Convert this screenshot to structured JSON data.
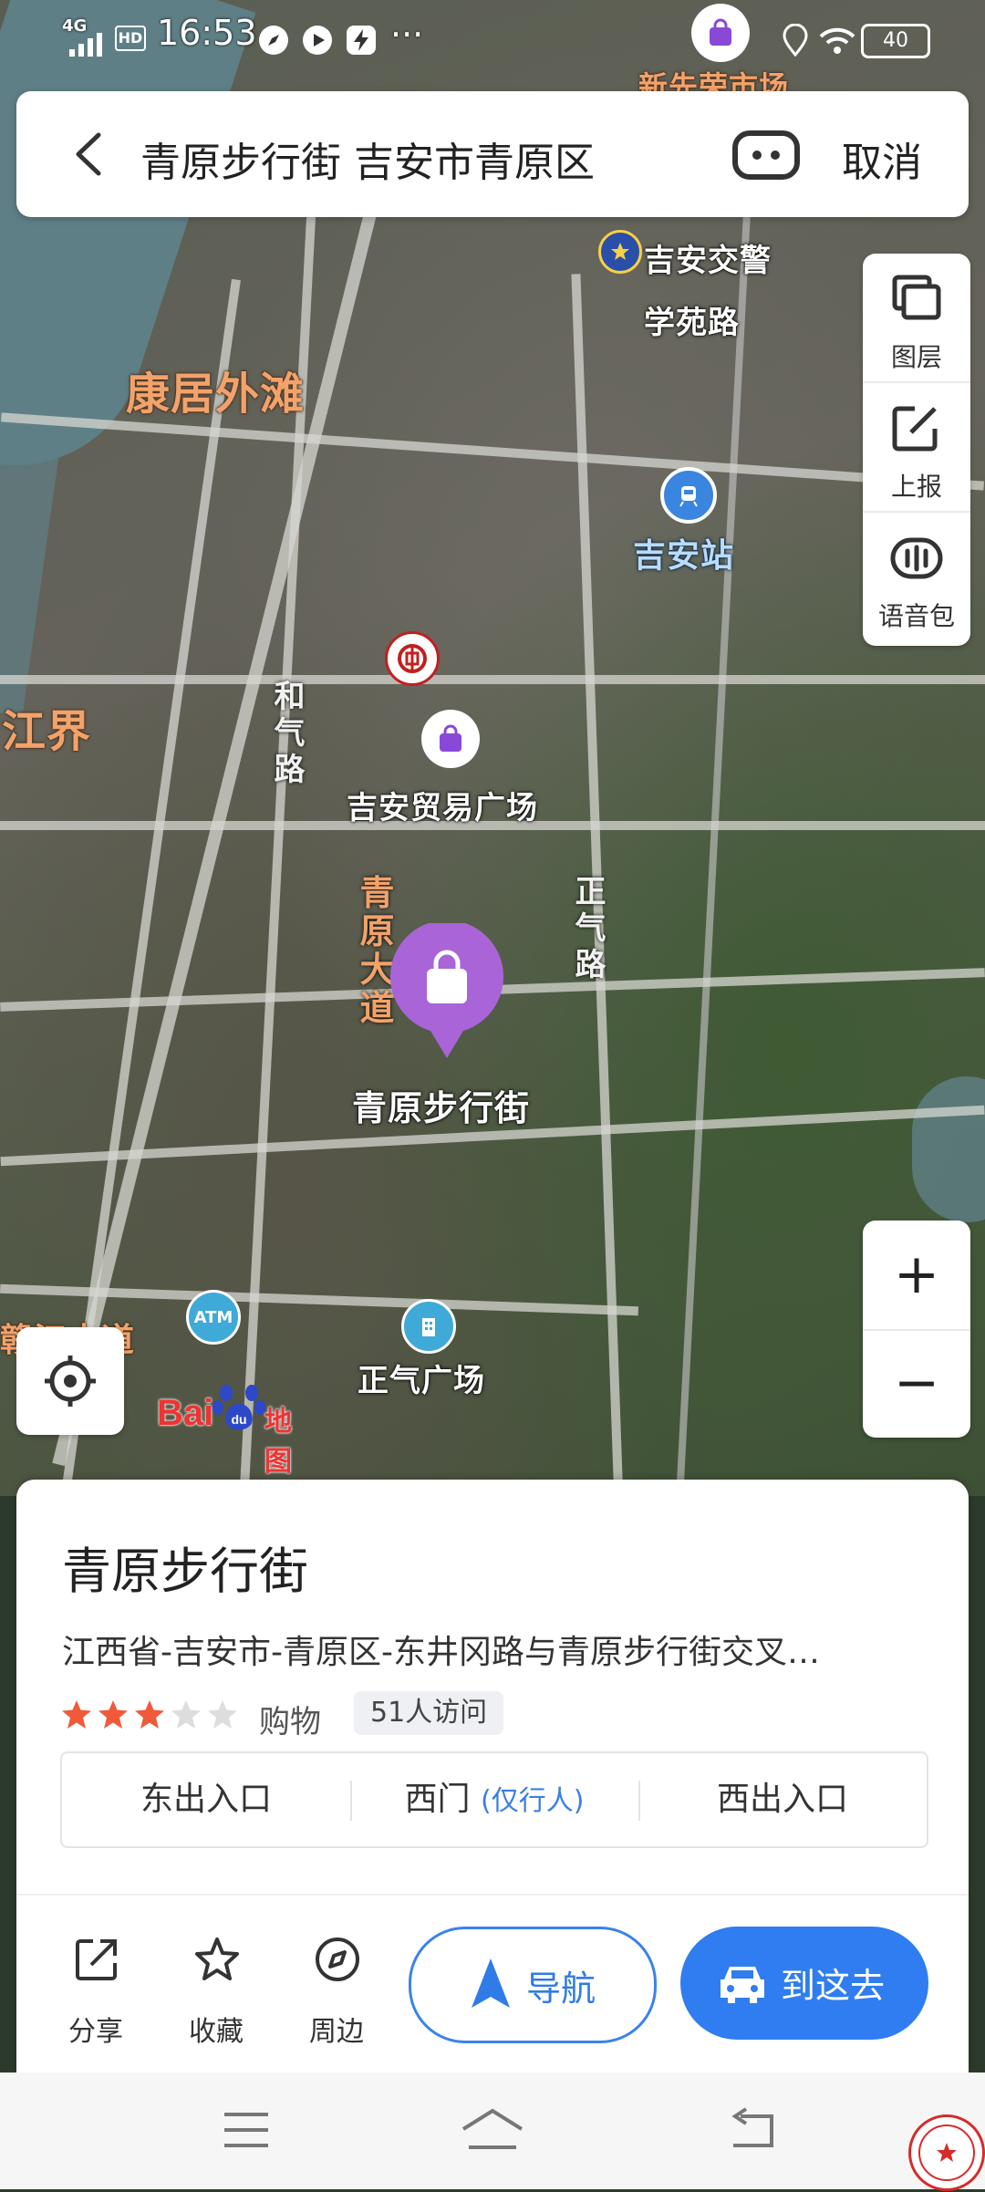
{
  "status_bar": {
    "network": "4G",
    "hd": "HD",
    "time": "16:53",
    "more": "···",
    "battery": "40"
  },
  "search": {
    "query": "青原步行街 吉安市青原区",
    "cancel_label": "取消"
  },
  "map": {
    "labels": {
      "kangju": "康居外滩",
      "jiangjie": "江界",
      "jian_jiaojing": "吉安交警",
      "xueyuan_road": "学苑路",
      "jian_station": "吉安站",
      "trade_plaza": "吉安贸易广场",
      "heqi_road": "和气路",
      "qingyuan_avenue": "青原大道",
      "zhengqi_road": "正气路",
      "pedestrian_street": "青原步行街",
      "zhengqi_plaza": "正气广场",
      "atm": "ATM",
      "partial_road": "赣江大道",
      "partial_top": "新先荣市场"
    },
    "selected_pin_color": "#a964d8"
  },
  "tools": [
    {
      "label": "图层",
      "icon": "layers-icon"
    },
    {
      "label": "上报",
      "icon": "report-edit-icon"
    },
    {
      "label": "语音包",
      "icon": "voice-pack-icon"
    }
  ],
  "zoom": {
    "in": "+",
    "out": "−"
  },
  "logo": {
    "bai": "Bai",
    "du": "du",
    "rest": "地图"
  },
  "place": {
    "name": "青原步行街",
    "address": "江西省-吉安市-青原区-东井冈路与青原步行街交叉…",
    "rating": 3,
    "rating_max": 5,
    "category": "购物",
    "visits": "51人访问",
    "entrances": [
      {
        "label": "东出入口",
        "note": ""
      },
      {
        "label": "西门",
        "note": "(仅行人)"
      },
      {
        "label": "西出入口",
        "note": ""
      }
    ]
  },
  "actions": {
    "share": "分享",
    "favorite": "收藏",
    "nearby": "周边",
    "navigate": "导航",
    "go_here": "到这去"
  },
  "colors": {
    "accent": "#2f7df0",
    "star_on": "#f05a3a",
    "star_off": "#dddddd"
  }
}
